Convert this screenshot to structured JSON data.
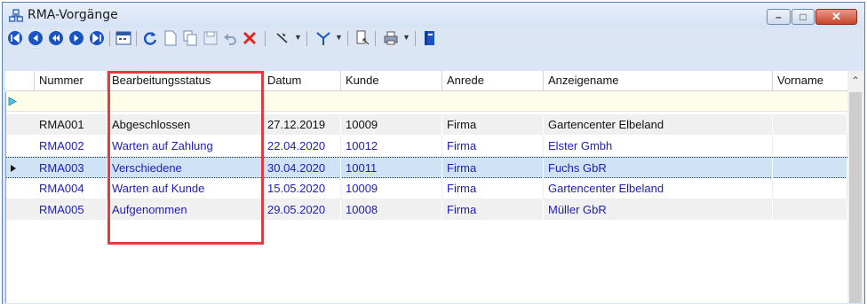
{
  "window": {
    "title": "RMA-Vorgänge",
    "title_icon": "group-icon",
    "buttons": {
      "minimize": "–",
      "maximize": "□",
      "close": "✕"
    }
  },
  "toolbar": {
    "items": [
      "first-record-icon",
      "previous-page-icon",
      "previous-record-icon",
      "next-record-icon",
      "last-record-icon",
      "calendar-icon",
      "refresh-icon",
      "new-document-icon",
      "copy-icon",
      "save-icon",
      "undo-icon",
      "delete-icon",
      "tools-dropdown-icon",
      "filter-icon",
      "export-icon",
      "print-icon",
      "book-icon"
    ]
  },
  "grid": {
    "columns": [
      "Nummer",
      "Bearbeitungsstatus",
      "Datum",
      "Kunde",
      "Anrede",
      "Anzeigename",
      "Vorname"
    ],
    "rows": [
      {
        "nummer": "RMA001",
        "status": "Abgeschlossen",
        "datum": "27.12.2019",
        "kunde": "10009",
        "anrede": "Firma",
        "anzeigename": "Gartencenter Elbeland",
        "vorname": ""
      },
      {
        "nummer": "RMA002",
        "status": "Warten auf Zahlung",
        "datum": "22.04.2020",
        "kunde": "10012",
        "anrede": "Firma",
        "anzeigename": "Elster Gmbh",
        "vorname": ""
      },
      {
        "nummer": "RMA003",
        "status": "Verschiedene",
        "datum": "30.04.2020",
        "kunde": "10011",
        "anrede": "Firma",
        "anzeigename": "Fuchs GbR",
        "vorname": ""
      },
      {
        "nummer": "RMA004",
        "status": "Warten auf Kunde",
        "datum": "15.05.2020",
        "kunde": "10009",
        "anrede": "Firma",
        "anzeigename": "Gartencenter Elbeland",
        "vorname": ""
      },
      {
        "nummer": "RMA005",
        "status": "Aufgenommen",
        "datum": "29.05.2020",
        "kunde": "10008",
        "anrede": "Firma",
        "anzeigename": "Müller GbR",
        "vorname": ""
      }
    ],
    "selected_row": "RMA003"
  },
  "colors": {
    "accent_red": "#e8393f",
    "link_blue": "#1d1cb8",
    "selection": "#cfe3f6",
    "new_row": "#fefdea"
  }
}
